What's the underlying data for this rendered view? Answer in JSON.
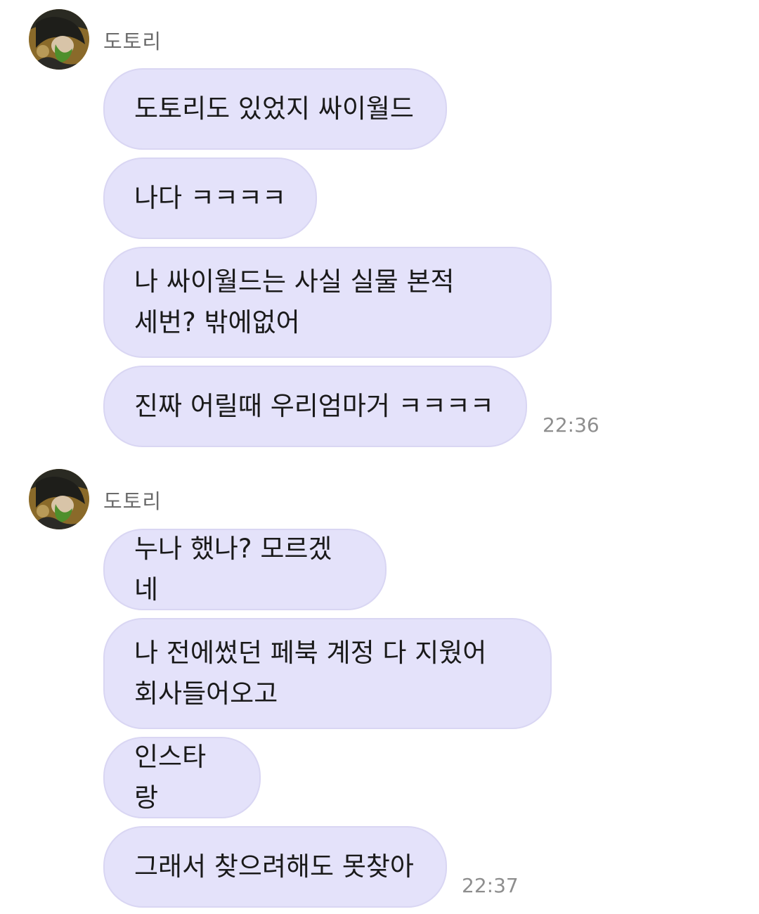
{
  "chat": {
    "groups": [
      {
        "sender": "도토리",
        "avatar_icon": "profile-photo-avatar",
        "time": "22:36",
        "messages": [
          "도토리도 있었지 싸이월드",
          "나다 ㅋㅋㅋㅋ",
          "나 싸이월드는 사실 실물 본적\n세번? 밖에없어",
          "진짜 어릴때 우리엄마거 ㅋㅋㅋㅋ"
        ]
      },
      {
        "sender": "도토리",
        "avatar_icon": "profile-photo-avatar",
        "time": "22:37",
        "messages": [
          "누나 했나? 모르겠네",
          "나 전에썼던 페북 계정 다 지웠어\n회사들어오고",
          "인스타랑",
          "그래서 찾으려해도 못찾아"
        ]
      }
    ]
  },
  "colors": {
    "bubble_bg": "#e4e2fa",
    "bubble_border": "#d9d6f3",
    "sender_text": "#6b6b6b",
    "time_text": "#8e8e8e"
  }
}
